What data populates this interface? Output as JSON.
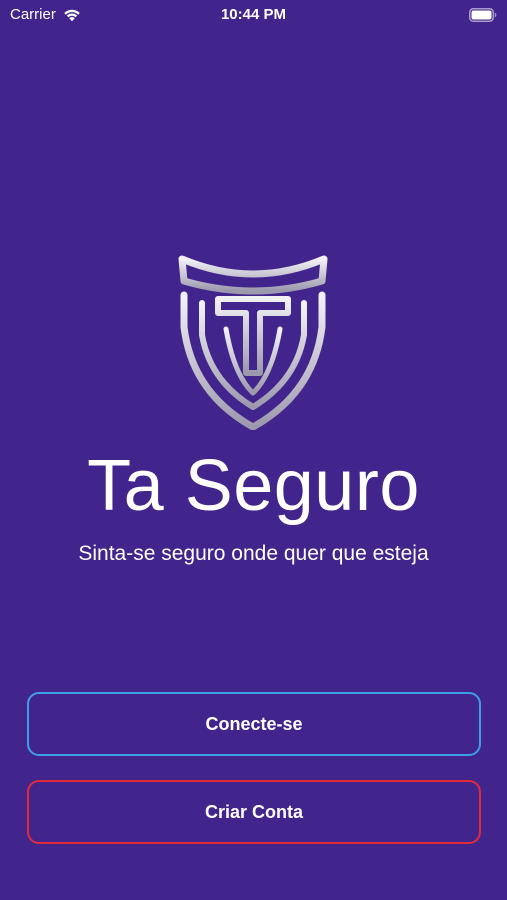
{
  "status_bar": {
    "carrier": "Carrier",
    "time": "10:44 PM",
    "icons": [
      "wifi-icon",
      "battery-icon"
    ]
  },
  "brand": {
    "logo_icon": "shield-t-logo",
    "title": "Ta Seguro",
    "tagline": "Sinta-se seguro onde quer que esteja"
  },
  "actions": {
    "login_label": "Conecte-se",
    "signup_label": "Criar Conta"
  },
  "colors": {
    "background": "#42258c",
    "text": "#ffffff",
    "login_border": "#3d9fe6",
    "signup_border": "#e02b3d",
    "logo_silver": "#c9c7d3"
  }
}
